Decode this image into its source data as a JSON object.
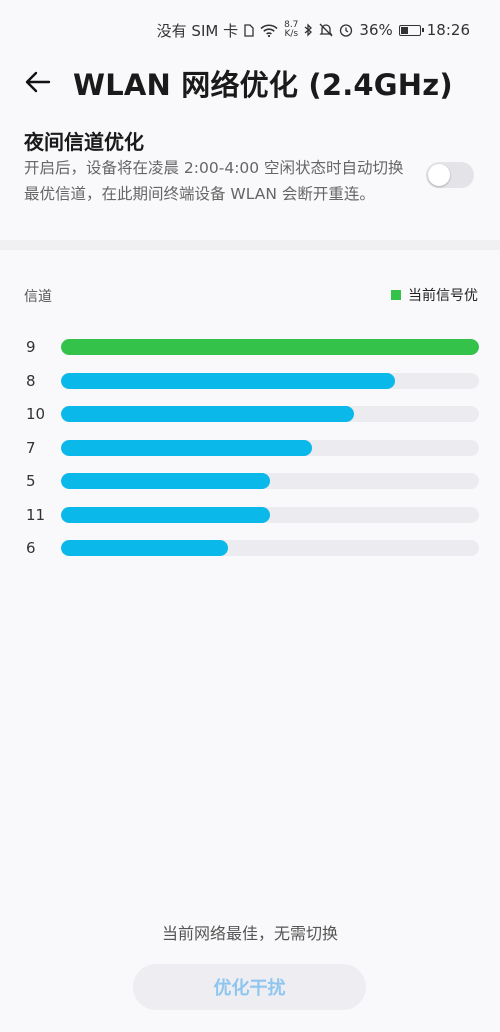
{
  "status_bar": {
    "carrier": "没有 SIM 卡",
    "net_speed_top": "8.7",
    "net_speed_bottom": "K/s",
    "battery": "36%",
    "time": "18:26",
    "icons": [
      "sim-card-icon",
      "wifi-icon",
      "bluetooth-icon",
      "mute-bell-icon",
      "alarm-icon",
      "battery-icon"
    ]
  },
  "header": {
    "title": "WLAN 网络优化 (2.4GHz)",
    "back_icon": "arrow-left-icon"
  },
  "night_optimization": {
    "title": "夜间信道优化",
    "description": "开启后，设备将在凌晨 2:00-4:00 空闲状态时自动切换最优信道，在此期间终端设备 WLAN 会断开重连。",
    "enabled": false
  },
  "chart_data": {
    "type": "bar",
    "orientation": "horizontal",
    "xlabel": "信道",
    "legend": "当前信号优",
    "legend_position": "top-right",
    "categories": [
      "9",
      "8",
      "10",
      "7",
      "5",
      "11",
      "6"
    ],
    "values": [
      1.0,
      0.8,
      0.7,
      0.6,
      0.5,
      0.5,
      0.4
    ],
    "xlim": [
      0,
      1
    ],
    "highlight_category": "9",
    "colors": {
      "highlight": "#35c24a",
      "normal": "#0ab8ea",
      "track": "#ececf0"
    }
  },
  "footer": {
    "status": "当前网络最佳，无需切换",
    "button_label": "优化干扰"
  }
}
